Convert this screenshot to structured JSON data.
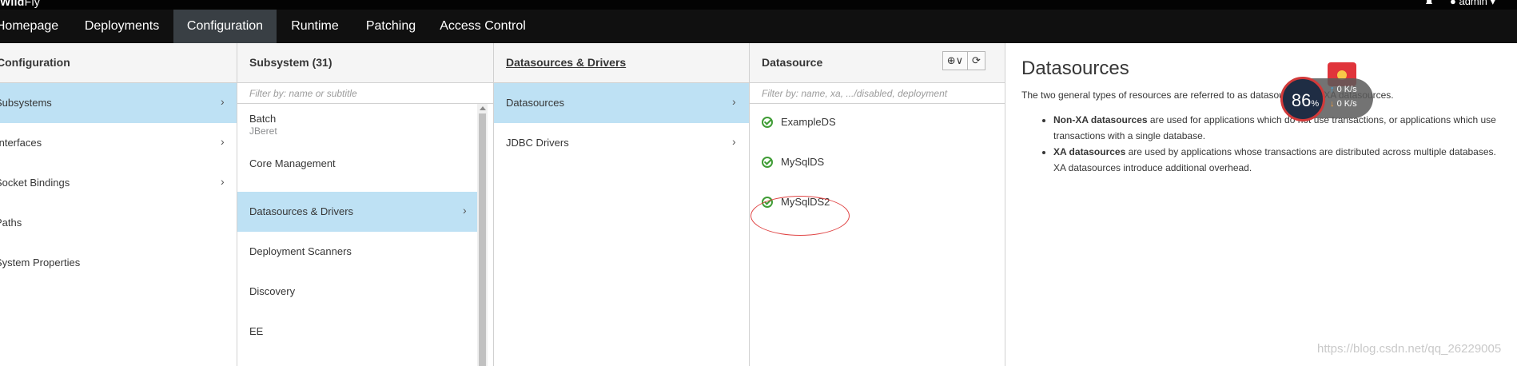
{
  "app": {
    "brand_bold": "Wild",
    "brand_thin": "Fly",
    "user": "admin"
  },
  "nav": {
    "tabs": [
      {
        "label": "Homepage",
        "active": false
      },
      {
        "label": "Deployments",
        "active": false
      },
      {
        "label": "Configuration",
        "active": true
      },
      {
        "label": "Runtime",
        "active": false
      },
      {
        "label": "Patching",
        "active": false
      },
      {
        "label": "Access Control",
        "active": false
      }
    ]
  },
  "configuration": {
    "title": "Configuration",
    "items": [
      {
        "label": "Subsystems",
        "selected": true
      },
      {
        "label": "Interfaces",
        "selected": false
      },
      {
        "label": "Socket Bindings",
        "selected": false
      },
      {
        "label": "Paths",
        "selected": false
      },
      {
        "label": "System Properties",
        "selected": false
      }
    ]
  },
  "subsystem": {
    "title": "Subsystem (31)",
    "filter_placeholder": "Filter by: name or subtitle",
    "items": [
      {
        "label": "Batch",
        "subtitle": "JBeret",
        "selected": false
      },
      {
        "label": "Core Management",
        "subtitle": "",
        "selected": false
      },
      {
        "label": "Datasources & Drivers",
        "subtitle": "",
        "selected": true
      },
      {
        "label": "Deployment Scanners",
        "subtitle": "",
        "selected": false
      },
      {
        "label": "Discovery",
        "subtitle": "",
        "selected": false
      },
      {
        "label": "EE",
        "subtitle": "",
        "selected": false
      }
    ]
  },
  "drivers": {
    "title": "Datasources & Drivers",
    "items": [
      {
        "label": "Datasources",
        "selected": true
      },
      {
        "label": "JDBC Drivers",
        "selected": false
      }
    ]
  },
  "datasource": {
    "title": "Datasource",
    "filter_placeholder": "Filter by: name, xa, .../disabled, deployment",
    "add_button": "⊕∨",
    "refresh_button": "⟳",
    "items": [
      {
        "label": "ExampleDS",
        "status": "ok"
      },
      {
        "label": "MySqlDS",
        "status": "ok"
      },
      {
        "label": "MySqlDS2",
        "status": "ok"
      }
    ]
  },
  "detail": {
    "title": "Datasources",
    "intro": "The two general types of resources are referred to as datasources and XA datasources.",
    "bullets": [
      {
        "bold": "Non-XA datasources",
        "text": " are used for applications which do not use transactions, or applications which use transactions with a single database."
      },
      {
        "bold": "XA datasources",
        "text": " are used by applications whose transactions are distributed across multiple databases. XA datasources introduce additional overhead."
      }
    ]
  },
  "monitor": {
    "percent": "86",
    "percent_unit": "%",
    "up": "0 K/s",
    "down": "0 K/s",
    "up_arrow": "↑",
    "down_arrow": "↓"
  },
  "watermark": "https://blog.csdn.net/qq_26229005",
  "colors": {
    "selected_bg": "#bee1f4",
    "nav_active": "#393f44",
    "ok_green": "#3f9c35",
    "annotation_red": "#e04545"
  }
}
